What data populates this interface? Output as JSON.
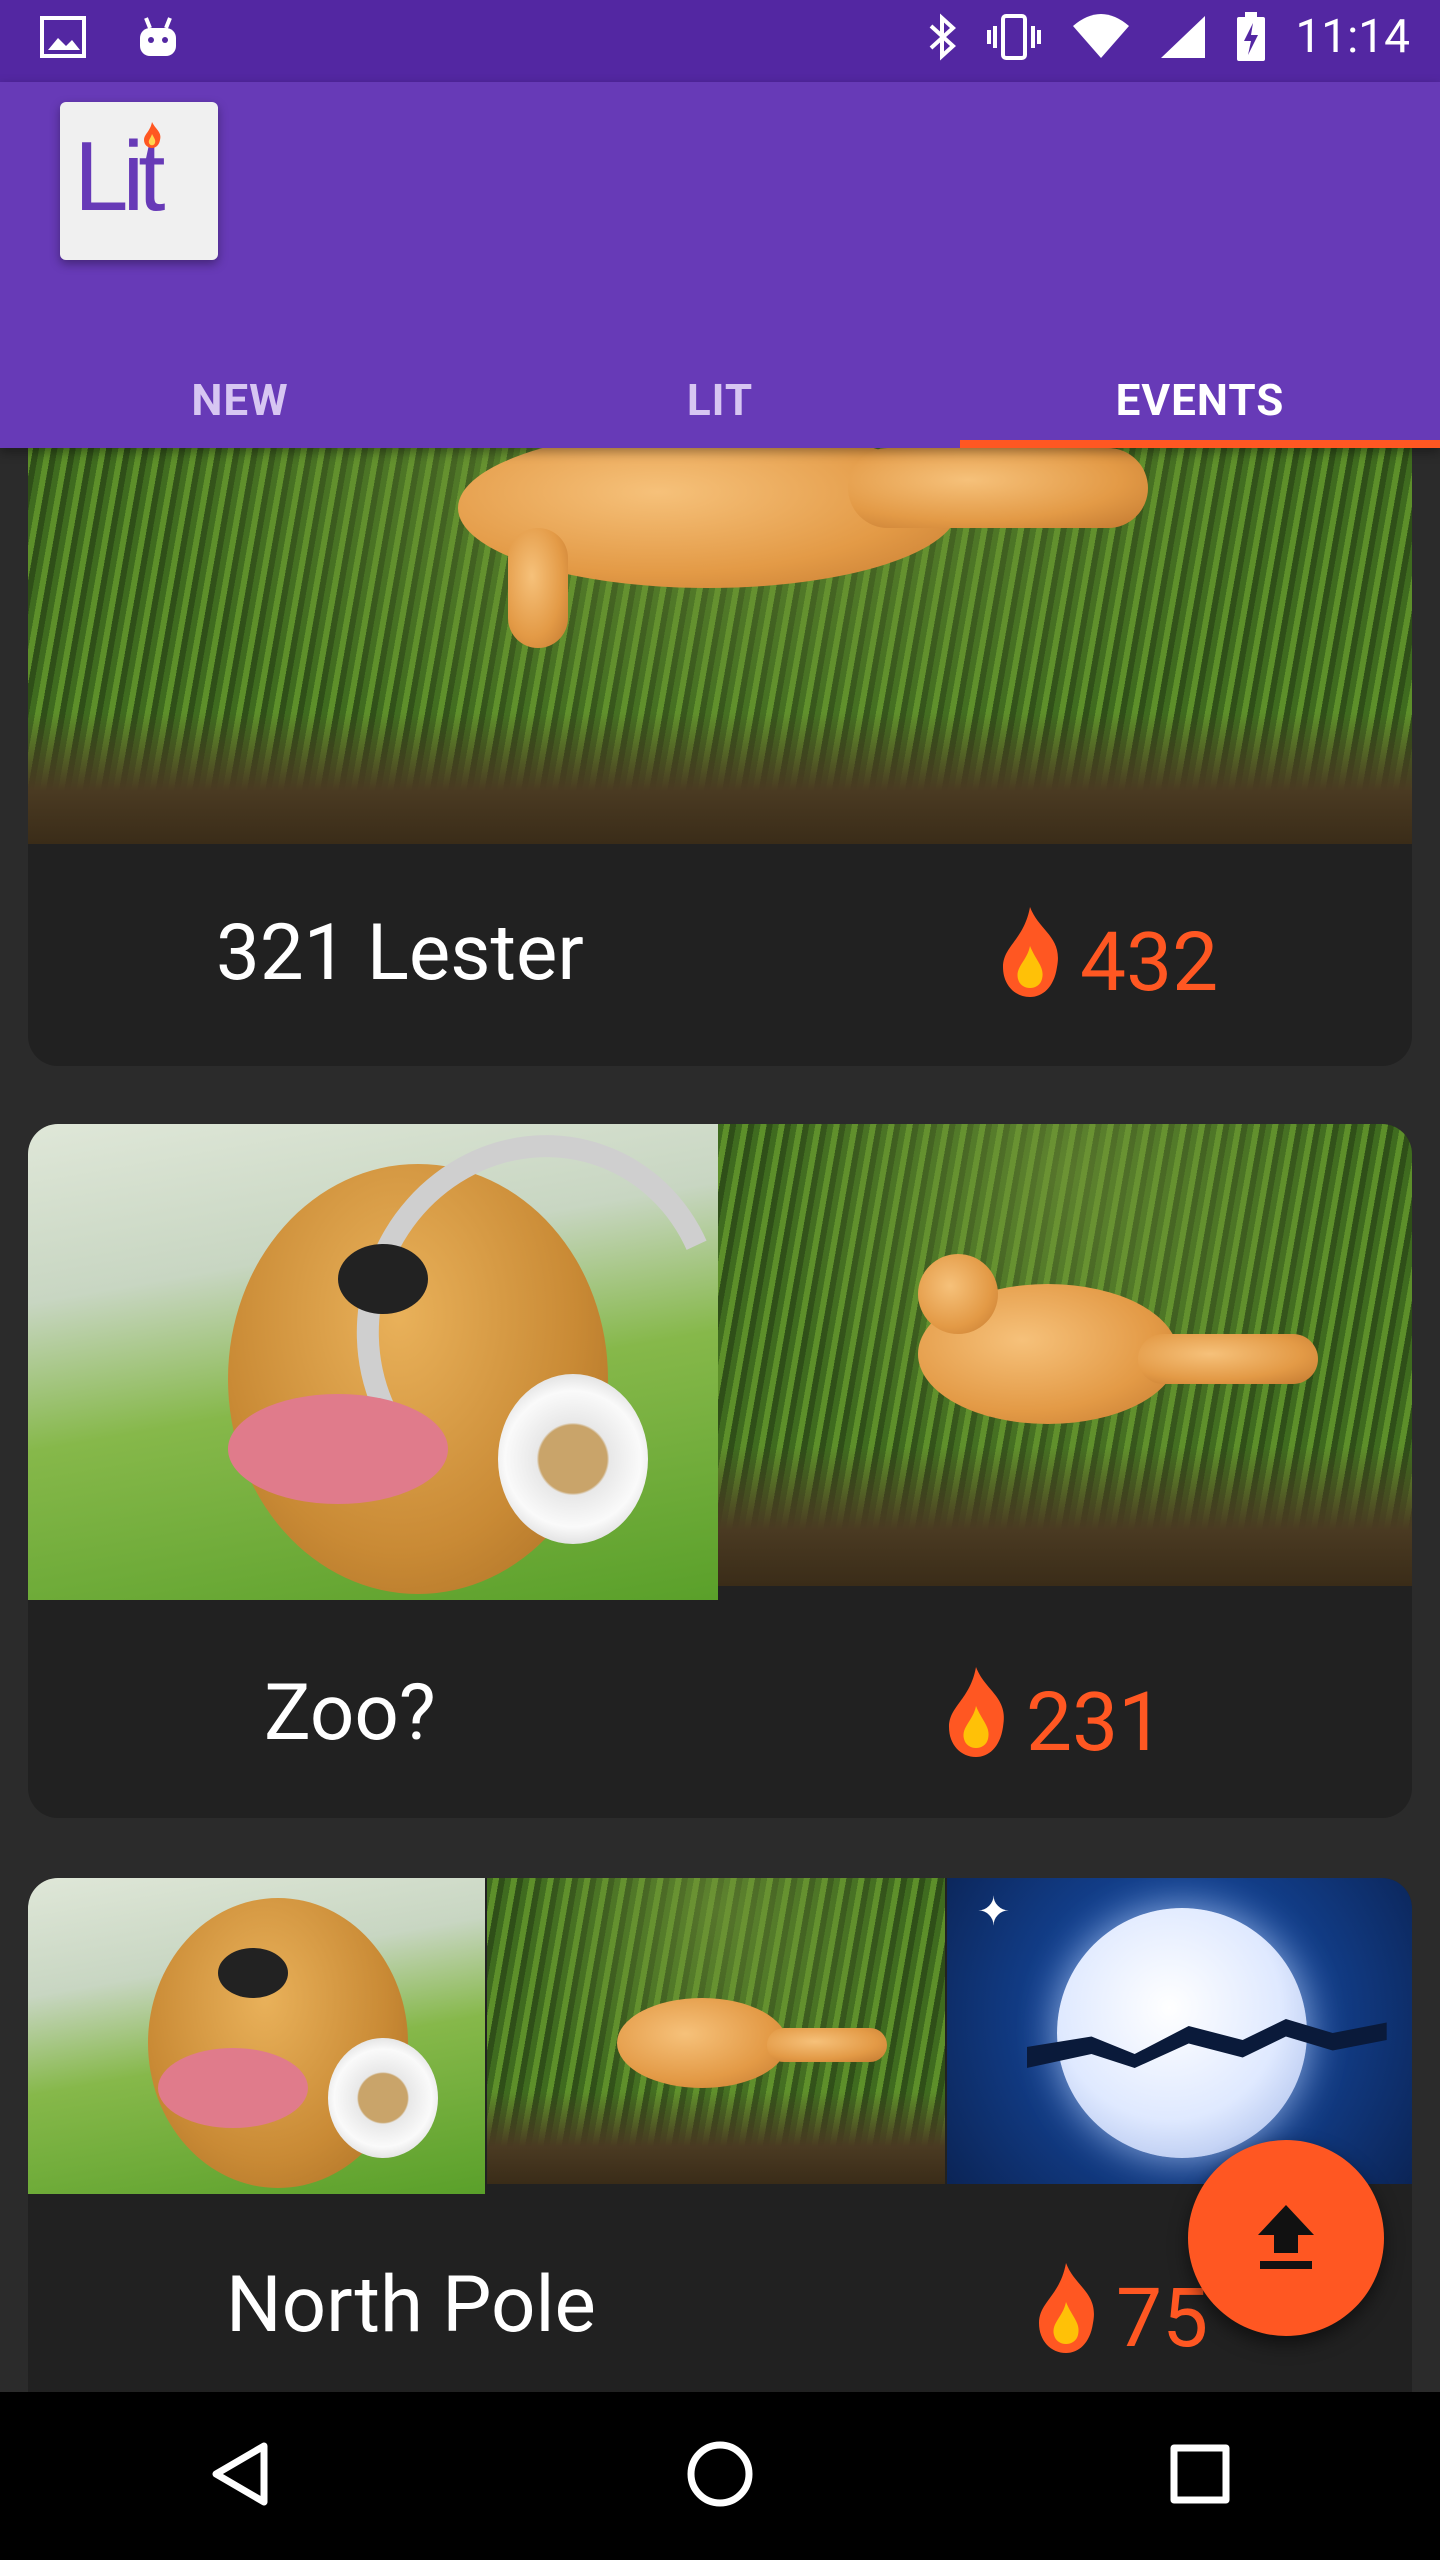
{
  "status_bar": {
    "time": "11:14"
  },
  "app": {
    "logo_text": "Lit"
  },
  "tabs": [
    {
      "label": "NEW",
      "active": false
    },
    {
      "label": "LIT",
      "active": false
    },
    {
      "label": "EVENTS",
      "active": true
    }
  ],
  "events": [
    {
      "title": "321 Lester",
      "lit_count": "432"
    },
    {
      "title": "Zoo?",
      "lit_count": "231"
    },
    {
      "title": "North Pole",
      "lit_count": "75"
    }
  ],
  "colors": {
    "primary": "#673ab7",
    "primary_dark": "#5327a2",
    "accent": "#ff5722",
    "card": "#212121"
  },
  "icons": {
    "status_left": [
      "image-icon",
      "android-icon"
    ],
    "status_right": [
      "bluetooth-icon",
      "vibrate-icon",
      "wifi-icon",
      "signal-icon",
      "battery-charging-icon"
    ],
    "fab": "upload-icon",
    "nav": [
      "back-icon",
      "home-icon",
      "recents-icon"
    ]
  }
}
